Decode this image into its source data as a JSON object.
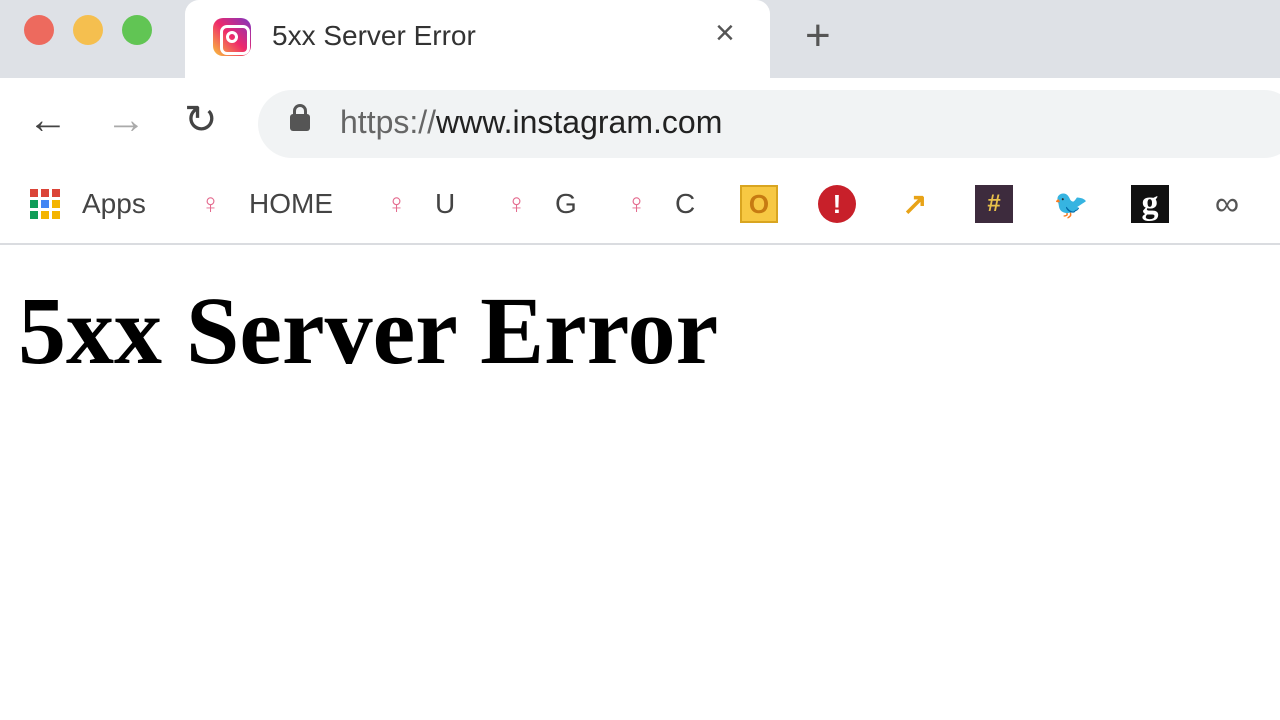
{
  "window": {
    "controls": [
      {
        "name": "close",
        "color": "#ed6a5e"
      },
      {
        "name": "minimize",
        "color": "#f5bf4f"
      },
      {
        "name": "maximize",
        "color": "#61c554"
      }
    ]
  },
  "tab": {
    "title": "5xx Server Error",
    "favicon": "instagram-icon",
    "close": "×"
  },
  "new_tab": "+",
  "toolbar": {
    "back": "←",
    "forward": "→",
    "reload": "↻",
    "url_scheme": "https://",
    "url_host": "www.instagram.com"
  },
  "bookmarks": [
    {
      "label": "Apps",
      "icon": "apps-grid-icon"
    },
    {
      "label": "HOME",
      "icon": "pink-figure-icon"
    },
    {
      "label": "U",
      "icon": "pink-figure-icon"
    },
    {
      "label": "G",
      "icon": "pink-figure-icon"
    },
    {
      "label": "C",
      "icon": "pink-figure-icon"
    },
    {
      "label": "",
      "icon": "orange-o-icon",
      "glyph": "O"
    },
    {
      "label": "",
      "icon": "red-exclamation-icon",
      "glyph": "!"
    },
    {
      "label": "",
      "icon": "trending-arrow-icon",
      "glyph": "↗"
    },
    {
      "label": "",
      "icon": "hashtag-icon",
      "glyph": "#"
    },
    {
      "label": "",
      "icon": "twitter-icon",
      "glyph": "🐦"
    },
    {
      "label": "",
      "icon": "g-icon",
      "glyph": "g"
    },
    {
      "label": "",
      "icon": "infinity-icon",
      "glyph": "∞"
    }
  ],
  "page": {
    "heading": "5xx Server Error"
  }
}
